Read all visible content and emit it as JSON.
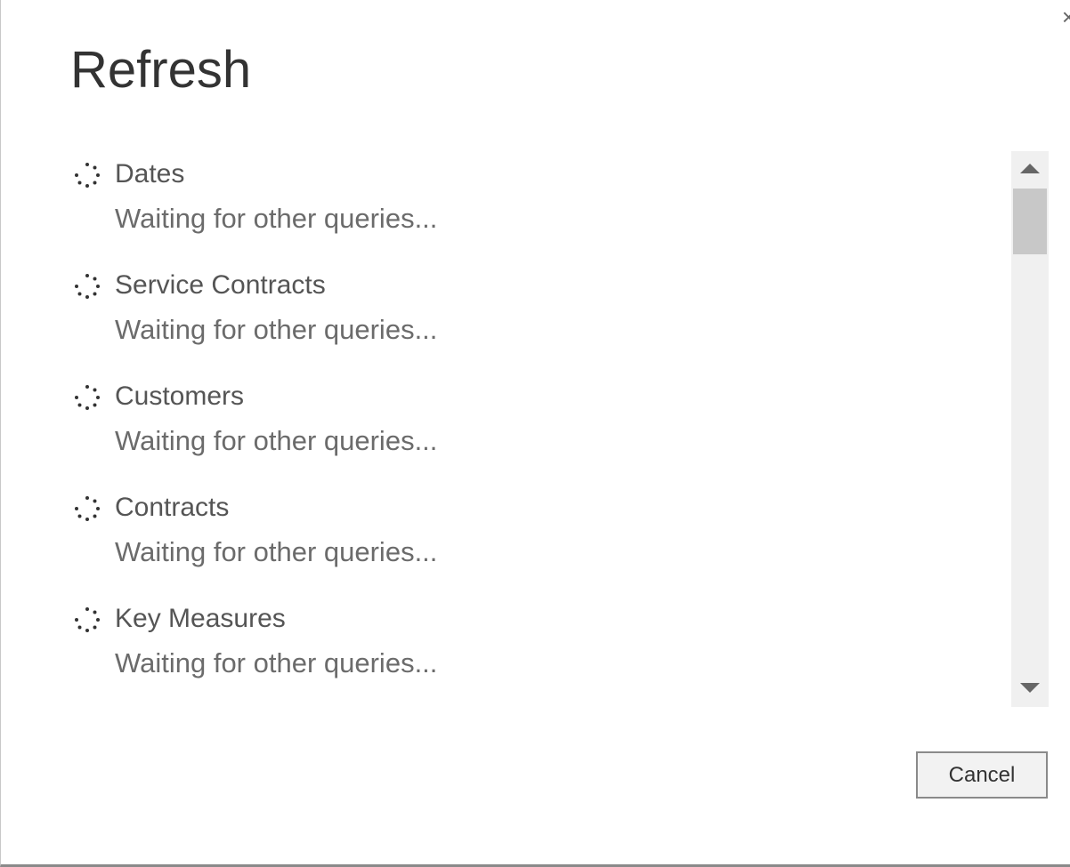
{
  "dialog": {
    "title": "Refresh",
    "close_glyph": "×"
  },
  "queries": [
    {
      "name": "Dates",
      "status": "Waiting for other queries...",
      "icon": "loading-spinner-icon"
    },
    {
      "name": "Service Contracts",
      "status": "Waiting for other queries...",
      "icon": "loading-spinner-icon"
    },
    {
      "name": "Customers",
      "status": "Waiting for other queries...",
      "icon": "loading-spinner-icon"
    },
    {
      "name": "Contracts",
      "status": "Waiting for other queries...",
      "icon": "loading-spinner-icon"
    },
    {
      "name": "Key Measures",
      "status": "Waiting for other queries...",
      "icon": "loading-spinner-icon"
    }
  ],
  "buttons": {
    "cancel_label": "Cancel"
  },
  "colors": {
    "title": "#333333",
    "query_name": "#555555",
    "query_status": "#6b6b6b",
    "scrollbar_track": "#f0f0f0",
    "scrollbar_thumb": "#c8c8c8",
    "spinner_dot": "#333333"
  }
}
